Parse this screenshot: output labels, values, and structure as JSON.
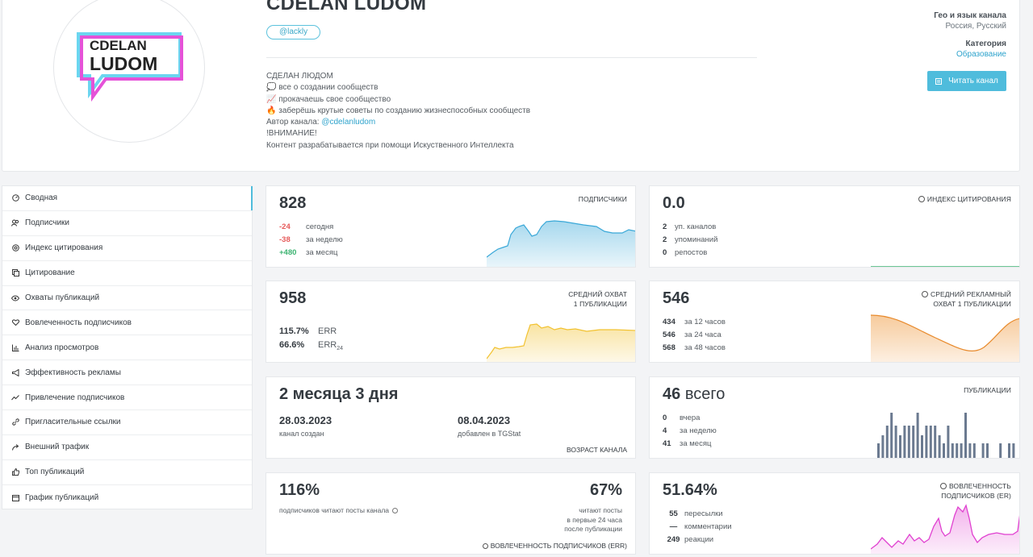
{
  "channel": {
    "title": "CDELAN LUDOM",
    "handle": "@lackly",
    "logo_text_top": "CDELAN",
    "logo_text_bottom": "LUDOM",
    "description": {
      "line1": "СДЕЛАН ЛЮДОМ",
      "line2": "💭 все о создании сообществ",
      "line3": "📈 прокачаешь свое сообщество",
      "line4": "🔥 заберёшь крутые советы по созданию жизнеспособных сообществ",
      "line5_prefix": "Автор канала: ",
      "line5_link": "@cdelanludom",
      "line6": "!ВНИМАНИЕ!",
      "line7": "Контент разрабатывается при помощи Искуственного Интеллекта"
    },
    "geo_label": "Гео и язык канала",
    "geo_value": "Россия, Русский",
    "category_label": "Категория",
    "category_value": "Образование",
    "read_button": "Читать канал"
  },
  "sidebar": {
    "items": [
      {
        "label": "Сводная",
        "icon": "dashboard-icon"
      },
      {
        "label": "Подписчики",
        "icon": "users-icon"
      },
      {
        "label": "Индекс цитирования",
        "icon": "at-icon"
      },
      {
        "label": "Цитирование",
        "icon": "quote-icon"
      },
      {
        "label": "Охваты публикаций",
        "icon": "eye-icon"
      },
      {
        "label": "Вовлеченность подписчиков",
        "icon": "heart-icon"
      },
      {
        "label": "Анализ просмотров",
        "icon": "bar-chart-icon"
      },
      {
        "label": "Эффективность рекламы",
        "icon": "megaphone-icon"
      },
      {
        "label": "Привлечение подписчиков",
        "icon": "trend-icon"
      },
      {
        "label": "Пригласительные ссылки",
        "icon": "link-icon"
      },
      {
        "label": "Внешний трафик",
        "icon": "share-icon"
      },
      {
        "label": "Топ публикаций",
        "icon": "thumbs-up-icon"
      },
      {
        "label": "График публикаций",
        "icon": "calendar-icon"
      }
    ]
  },
  "subscribers": {
    "value": "828",
    "label": "ПОДПИСЧИКИ",
    "rows": [
      {
        "num": "-24",
        "text": "сегодня"
      },
      {
        "num": "-38",
        "text": "за неделю"
      },
      {
        "num": "+480",
        "text": "за месяц"
      }
    ]
  },
  "citation": {
    "value": "0.0",
    "label": "ИНДЕКС ЦИТИРОВАНИЯ",
    "rows": [
      {
        "num": "2",
        "text": "уп. каналов"
      },
      {
        "num": "2",
        "text": "упоминаний"
      },
      {
        "num": "0",
        "text": "репостов"
      }
    ]
  },
  "reach": {
    "value": "958",
    "label_line1": "СРЕДНИЙ ОХВАТ",
    "label_line2": "1 ПУБЛИКАЦИИ",
    "err": "115.7%",
    "err_label": "ERR",
    "err24": "66.6%",
    "err24_label": "ERR",
    "err24_sub": "24"
  },
  "ad_reach": {
    "value": "546",
    "label_line1": "СРЕДНИЙ РЕКЛАМНЫЙ",
    "label_line2": "ОХВАТ 1 ПУБЛИКАЦИИ",
    "rows": [
      {
        "num": "434",
        "text": "за 12 часов"
      },
      {
        "num": "546",
        "text": "за 24 часа"
      },
      {
        "num": "568",
        "text": "за 48 часов"
      }
    ]
  },
  "age": {
    "value": "2 месяца 3 дня",
    "created_date": "28.03.2023",
    "created_label": "канал создан",
    "added_date": "08.04.2023",
    "added_label": "добавлен в TGStat",
    "label": "ВОЗРАСТ КАНАЛА"
  },
  "posts": {
    "value": "46",
    "unit": "всего",
    "label": "ПУБЛИКАЦИИ",
    "rows": [
      {
        "num": "0",
        "text": "вчера"
      },
      {
        "num": "4",
        "text": "за неделю"
      },
      {
        "num": "41",
        "text": "за месяц"
      }
    ]
  },
  "engagement_err": {
    "value": "116%",
    "note": "подписчиков читают посты канала",
    "right_value": "67%",
    "right_note_1": "читают посты",
    "right_note_2": "в первые 24 часа",
    "right_note_3": "после публикации",
    "label": "ВОВЛЕЧЕННОСТЬ ПОДПИСЧИКОВ (ERR)"
  },
  "engagement_er": {
    "value": "51.64%",
    "label_line1": "ВОВЛЕЧЕННОСТЬ",
    "label_line2": "ПОДПИСЧИКОВ (ER)",
    "rows": [
      {
        "num": "55",
        "text": "пересылки"
      },
      {
        "num": "—",
        "text": "комментарии"
      },
      {
        "num": "249",
        "text": "реакции"
      }
    ]
  },
  "colors": {
    "accent": "#4fbcdc",
    "blue_chart": "#3aa8d8",
    "yellow_chart": "#f2c230",
    "orange_chart": "#f0a04b",
    "bar_chart": "#6b7a90",
    "pink_chart": "#e040d0",
    "green_line": "#3cb371"
  }
}
